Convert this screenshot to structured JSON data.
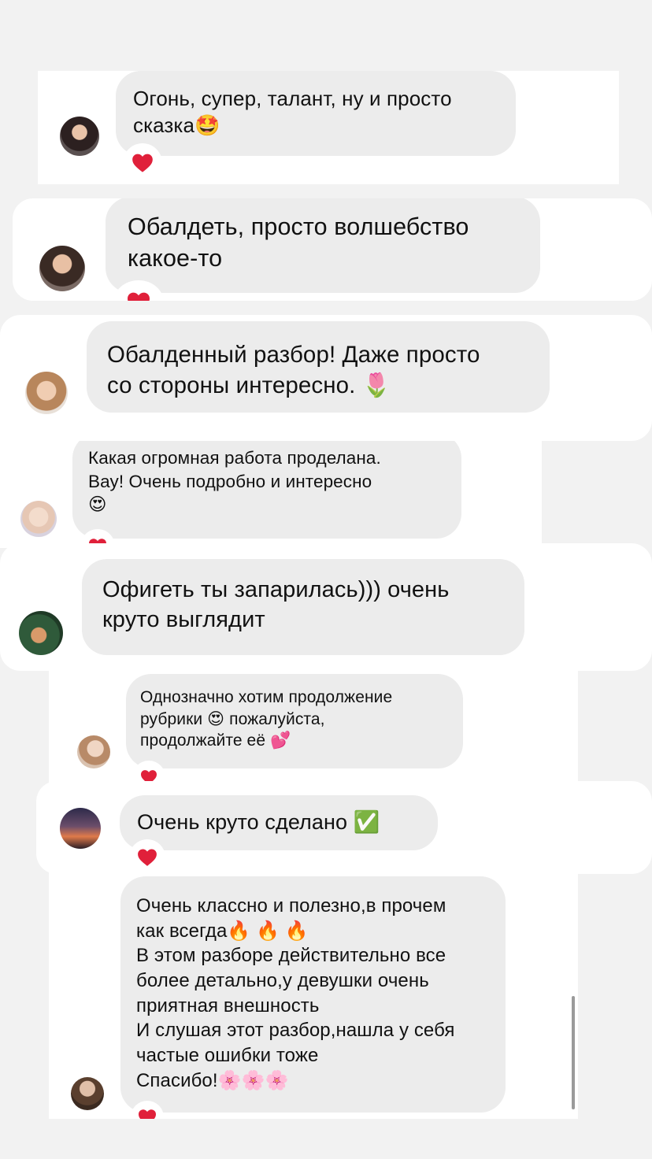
{
  "comments": [
    {
      "lines": [
        "Огонь, супер, талант, ну и просто",
        "сказка🤩"
      ],
      "liked": true
    },
    {
      "lines": [
        "Обалдеть, просто волшебство",
        "какое-то"
      ],
      "liked": true
    },
    {
      "lines": [
        "Обалденный разбор! Даже просто",
        "со стороны интересно. 🌷"
      ],
      "liked": false
    },
    {
      "lines": [
        "Какая огромная работа проделана.",
        "Вау! Очень подробно и интересно",
        "😍"
      ],
      "liked": true
    },
    {
      "lines": [
        "Офигеть ты запарилась))) очень",
        "круто выглядит"
      ],
      "liked": false
    },
    {
      "lines": [
        "Однозначно хотим продолжение",
        "рубрики 😍  пожалуйста,",
        "продолжайте её 💕"
      ],
      "liked": true
    },
    {
      "lines": [
        "Очень круто сделано ✅"
      ],
      "liked": true
    },
    {
      "lines": [
        "Очень классно и полезно,в прочем",
        "как всегда🔥 🔥 🔥",
        "В этом разборе действительно все",
        "более детально,у девушки очень",
        "приятная внешность",
        "И слушая этот разбор,нашла у себя",
        "частые ошибки тоже",
        "Спасибо!🌸🌸🌸"
      ],
      "liked": true
    }
  ],
  "colors": {
    "background": "#f2f2f2",
    "card": "#ffffff",
    "bubble": "#ececec",
    "heart": "#e0203a",
    "scrollbar": "#9a9a9a"
  },
  "icons": {
    "like": "heart-icon"
  }
}
